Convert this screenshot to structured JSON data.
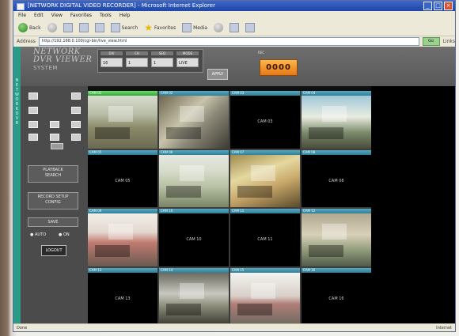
{
  "window": {
    "title": "[NETWORK DIGITAL VIDEO RECORDER] - Microsoft Internet Explorer"
  },
  "menu": [
    "File",
    "Edit",
    "View",
    "Favorites",
    "Tools",
    "Help"
  ],
  "toolbar": {
    "back_label": "Back",
    "search_label": "Search",
    "favorites_label": "Favorites",
    "media_label": "Media"
  },
  "address": {
    "label": "Address",
    "url": "http://192.168.0.100/cgi-bin/live_view.html",
    "go_label": "Go",
    "links_label": "Links"
  },
  "app": {
    "logo_line1": "NETWORK",
    "logo_line2": "DVR VIEWER",
    "logo_line3": "SYSTEM",
    "orange_caption": "REC",
    "orange_value": "0000",
    "apply_label": "APPLY",
    "green_strip_text": "N E T W O R K   D V R"
  },
  "controls": {
    "headers": [
      "DIV",
      "CH",
      "SEQ",
      "MODE"
    ],
    "values": [
      "16",
      "1",
      "1",
      "LIVE"
    ]
  },
  "sidebar": {
    "button1_line1": "PLAYBACK",
    "button1_line2": "SEARCH",
    "button2_line1": "RECORD SETUP",
    "button2_line2": "CONFIG",
    "button3_label": "SAVE",
    "radio1": "AUTO",
    "radio2": "ON",
    "logout_label": "LOGOUT"
  },
  "cameras": [
    {
      "name": "CAM 01",
      "status": "live",
      "feed": "feed1"
    },
    {
      "name": "CAM 02",
      "status": "live",
      "feed": "feed2"
    },
    {
      "name": "CAM 03",
      "status": "no-signal",
      "text": "CAM 03"
    },
    {
      "name": "CAM 04",
      "status": "live",
      "feed": "feed3"
    },
    {
      "name": "CAM 05",
      "status": "no-signal",
      "text": "CAM 05"
    },
    {
      "name": "CAM 06",
      "status": "live",
      "feed": "feed4"
    },
    {
      "name": "CAM 07",
      "status": "live",
      "feed": "feed5"
    },
    {
      "name": "CAM 08",
      "status": "no-signal",
      "text": "CAM 08"
    },
    {
      "name": "CAM 09",
      "status": "live",
      "feed": "feed6"
    },
    {
      "name": "CAM 10",
      "status": "no-signal",
      "text": "CAM 10"
    },
    {
      "name": "CAM 11",
      "status": "no-signal",
      "text": "CAM 11"
    },
    {
      "name": "CAM 12",
      "status": "live",
      "feed": "feed7"
    },
    {
      "name": "CAM 13",
      "status": "no-signal",
      "text": "CAM 13"
    },
    {
      "name": "CAM 14",
      "status": "live",
      "feed": "feed8"
    },
    {
      "name": "CAM 15",
      "status": "live",
      "feed": "feed9"
    },
    {
      "name": "CAM 16",
      "status": "no-signal",
      "text": "CAM 16"
    }
  ],
  "status": {
    "left": "Done",
    "right": "Internet"
  },
  "colors": {
    "accent_green": "#2a9b86",
    "orange": "#f0901e",
    "titlebar_blue": "#1f47a8"
  }
}
